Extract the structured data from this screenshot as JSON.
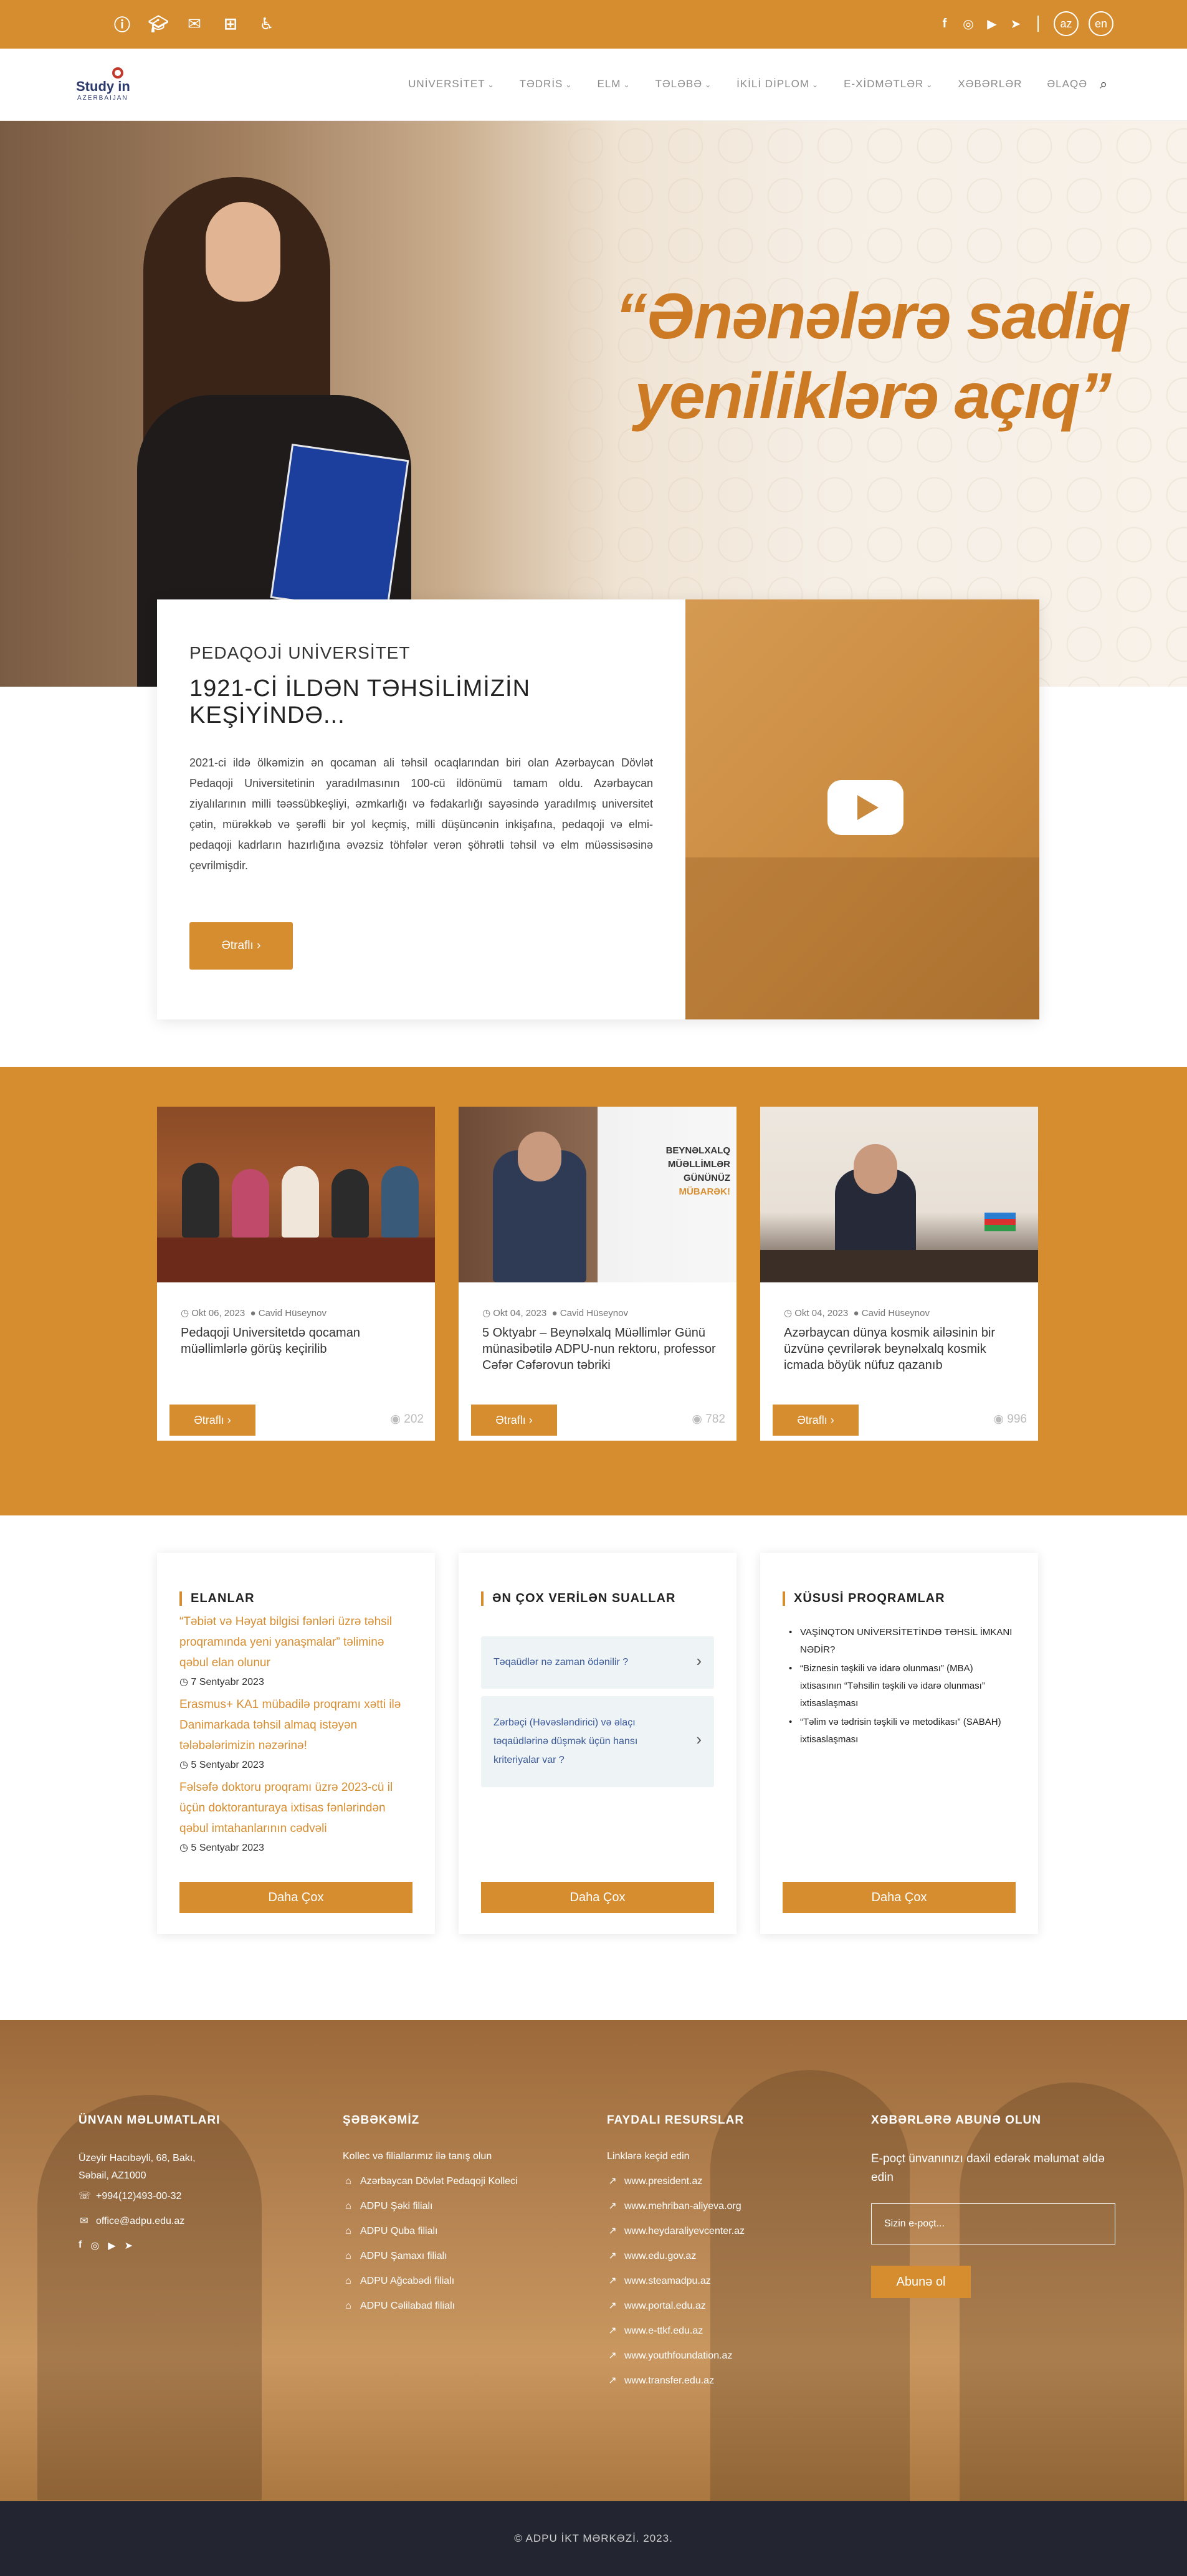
{
  "topbar": {
    "left_icons": [
      "info-icon",
      "graduation-cap-icon",
      "envelope-icon",
      "sitemap-icon",
      "accessibility-icon"
    ],
    "social_icons": [
      "facebook-icon",
      "instagram-icon",
      "youtube-icon",
      "telegram-icon"
    ],
    "languages": [
      "az",
      "en"
    ]
  },
  "nav": {
    "logo_text": "Study in",
    "logo_sub": "AZERBAIJAN",
    "items": [
      "UNİVERSİTET",
      "TƏDRİS",
      "ELM",
      "TƏLƏBƏ",
      "İKİLİ DİPLOM",
      "E-XİDMƏTLƏR",
      "XƏBƏRLƏR",
      "ƏLAQƏ"
    ]
  },
  "hero": {
    "quote_line1": "“Ənənələrə sadiq",
    "quote_line2": "yeniliklərə açıq”"
  },
  "about": {
    "kicker": "PEDAQOJİ UNİVERSİTET",
    "title": "1921-Cİ İLDƏN TƏHSİLİMİZİN KEŞİYİNDƏ...",
    "description": "2021-ci ildə ölkəmizin ən qocaman ali təhsil ocaqlarından biri olan Azərbaycan Dövlət Pedaqoji Universitetinin yaradılmasının 100-cü ildönümü tamam oldu. Azərbaycan ziyalılarının milli təəssübkeşliyi, əzmkarlığı və fədakarlığı sayəsində yaradılmış universitet çətin, mürəkkəb və şərəfli bir yol keçmiş, milli düşüncənin inkişafına, pedaqoji və elmi-pedaqoji kadrların hazırlığına əvəzsiz töhfələr verən  şöhrətli təhsil və elm müəssisəsinə çevrilmişdir.",
    "button": "Ətraflı ›"
  },
  "news": [
    {
      "date": "Okt 06, 2023",
      "author": "Cavid Hüseynov",
      "title": "Pedaqoji Universitetdə qocaman müəllimlərlə görüş keçirilib",
      "button": "Ətraflı ›",
      "views": "202"
    },
    {
      "date": "Okt 04, 2023",
      "author": "Cavid Hüseynov",
      "title": "5 Oktyabr – Beynəlxalq Müəllimlər Günü münasibətilə ADPU-nun rektoru, professor Cəfər Cəfərovun təbriki",
      "button": "Ətraflı ›",
      "views": "782",
      "banner": [
        "BEYNƏLXALQ",
        "MÜƏLLİMLƏR",
        "GÜNÜNÜZ",
        "MÜBARƏK!"
      ]
    },
    {
      "date": "Okt 04, 2023",
      "author": "Cavid Hüseynov",
      "title": "Azərbaycan dünya kosmik ailəsinin bir üzvünə çevrilərək beynəlxalq kosmik icmada böyük nüfuz qazanıb",
      "button": "Ətraflı ›",
      "views": "996"
    }
  ],
  "announcements": {
    "heading": "ELANLAR",
    "items": [
      {
        "text": "“Təbiət və Həyat bilgisi fənləri üzrə təhsil proqramında yeni yanaşmalar” təliminə qəbul elan olunur",
        "date": "7 Sentyabr 2023"
      },
      {
        "text": "Erasmus+ KA1 mübadilə proqramı xətti ilə Danimarkada təhsil almaq istəyən tələbələrimizin nəzərinə!",
        "date": "5 Sentyabr 2023"
      },
      {
        "text": "Fəlsəfə doktoru proqramı üzrə 2023-cü il üçün doktoranturaya ixtisas fənlərindən qəbul imtahanlarının cədvəli",
        "date": "5 Sentyabr 2023"
      }
    ],
    "button": "Daha Çox"
  },
  "faq": {
    "heading": "ƏN ÇOX VERİLƏN SUALLAR",
    "items": [
      "Təqaüdlər nə zaman ödənilir ?",
      "Zərbəçi (Həvəsləndirici) və əlaçı təqaüdlərinə düşmək üçün hansı kriteriyalar var ?"
    ],
    "button": "Daha Çox"
  },
  "programs": {
    "heading": "XÜSUSİ PROQRAMLAR",
    "items": [
      "VAŞİNQTON UNİVERSİTETİNDƏ TƏHSİL İMKANI NƏDİR?",
      "“Biznesin təşkili və idarə olunması” (MBA) ixtisasının “Təhsilin təşkili və idarə olunması” ixtisaslaşması",
      "“Təlim və tədrisin təşkili və metodikası” (SABAH) ixtisaslaşması"
    ],
    "button": "Daha Çox"
  },
  "footer": {
    "address": {
      "heading": "ÜNVAN MƏLUMATLARI",
      "address_text": "Üzeyir Hacıbəyli, 68, Bakı, Səbail, AZ1000",
      "phone": "+994(12)493-00-32",
      "email": "office@adpu.edu.az"
    },
    "network": {
      "heading": "ŞƏBƏKƏMİZ",
      "intro": "Kollec və filiallarımız ilə tanış olun",
      "items": [
        "Azərbaycan Dövlət Pedaqoji Kolleci",
        "ADPU Şəki filialı",
        "ADPU Quba filialı",
        "ADPU Şamaxı filialı",
        "ADPU Ağcabədi filialı",
        "ADPU Cəlilabad filialı"
      ]
    },
    "resources": {
      "heading": "FAYDALI RESURSLAR",
      "intro": "Linklərə keçid edin",
      "items": [
        "www.president.az",
        "www.mehriban-aliyeva.org",
        "www.heydaraliyevcenter.az",
        "www.edu.gov.az",
        "www.steamadpu.az",
        "www.portal.edu.az",
        "www.e-ttkf.edu.az",
        "www.youthfoundation.az",
        "www.transfer.edu.az"
      ]
    },
    "subscribe": {
      "heading": "XƏBƏRLƏRƏ ABUNƏ OLUN",
      "text": "E-poçt ünvanınızı daxil edərək məlumat əldə edin",
      "placeholder": "Sizin e-poçt...",
      "button": "Abunə ol"
    },
    "copyright": "© ADPU İKT MƏRKƏZİ. 2023."
  }
}
